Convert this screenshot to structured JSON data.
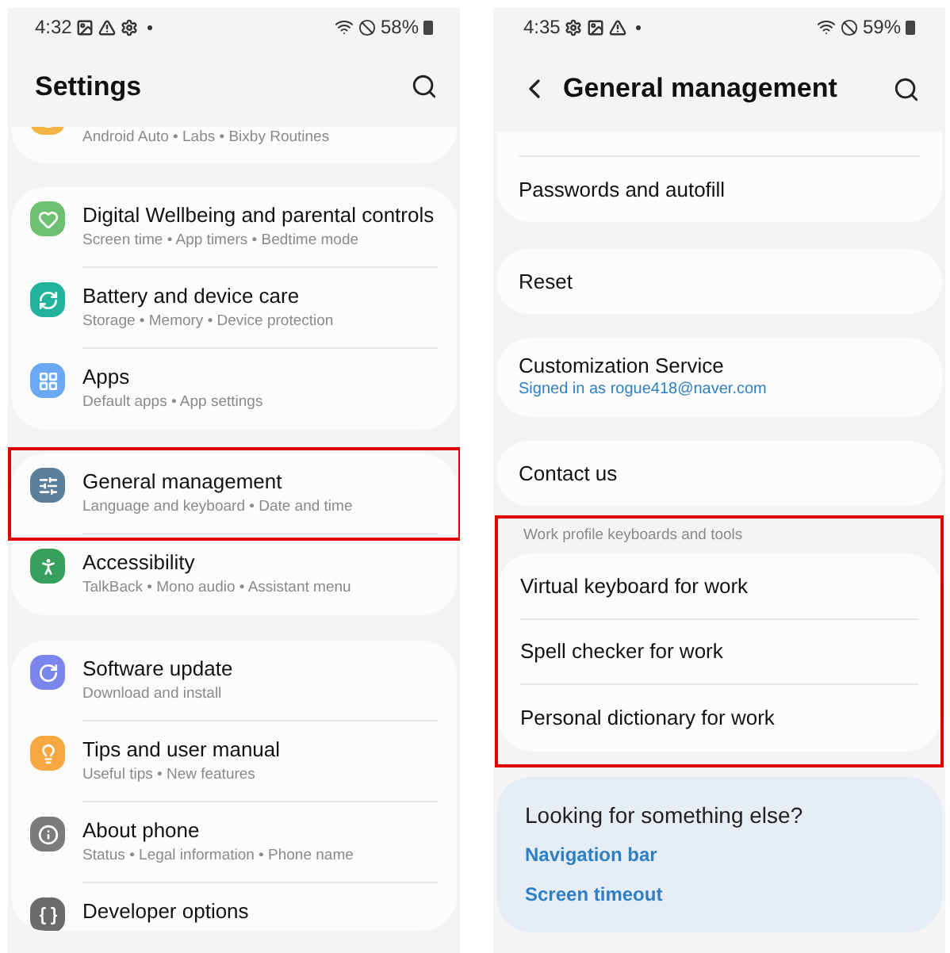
{
  "screens": [
    {
      "status_bar": {
        "time": "4:32",
        "notification_icons": [
          {
            "kind": "image"
          },
          {
            "kind": "warning"
          },
          {
            "kind": "gear"
          },
          {
            "kind": "dot"
          }
        ],
        "battery": "58%"
      },
      "header": {
        "title": "Settings",
        "back": false
      },
      "groups": [
        {
          "kind": "partial",
          "items": [
            {
              "kind": "auto",
              "color": "#f5b544",
              "subtitle": "Android Auto • Labs • Bixby Routines"
            }
          ]
        },
        {
          "kind": "card",
          "items": [
            {
              "kind": "wellbeing",
              "color": "#6cc070",
              "title": "Digital Wellbeing and parental controls",
              "subtitle": "Screen time • App timers • Bedtime mode",
              "highlighted": false
            },
            {
              "kind": "battery",
              "color": "#21b29b",
              "title": "Battery and device care",
              "subtitle": "Storage • Memory • Device protection",
              "highlighted": false
            },
            {
              "kind": "apps",
              "color": "#6aa8f4",
              "title": "Apps",
              "subtitle": "Default apps • App settings",
              "highlighted": false
            }
          ]
        },
        {
          "kind": "card",
          "items": [
            {
              "kind": "general",
              "color": "#5b7f99",
              "title": "General management",
              "subtitle": "Language and keyboard • Date and time",
              "highlighted": true
            },
            {
              "kind": "accessibility",
              "color": "#36a05c",
              "title": "Accessibility",
              "subtitle": "TalkBack • Mono audio • Assistant menu",
              "highlighted": false
            }
          ]
        },
        {
          "kind": "clipped",
          "items": [
            {
              "kind": "update",
              "color": "#7a86ec",
              "title": "Software update",
              "subtitle": "Download and install",
              "highlighted": false
            },
            {
              "kind": "tips",
              "color": "#f5a742",
              "title": "Tips and user manual",
              "subtitle": "Useful tips • New features",
              "highlighted": false
            },
            {
              "kind": "about",
              "color": "#7b7b7b",
              "title": "About phone",
              "subtitle": "Status • Legal information • Phone name",
              "highlighted": false
            },
            {
              "kind": "developer",
              "color": "#6b6b6b",
              "title": "Developer options",
              "highlighted": false
            }
          ]
        }
      ]
    },
    {
      "status_bar": {
        "time": "4:35",
        "notification_icons": [
          {
            "kind": "gear"
          },
          {
            "kind": "image"
          },
          {
            "kind": "warning"
          },
          {
            "kind": "dot"
          }
        ],
        "battery": "59%"
      },
      "header": {
        "title": "General management",
        "back": true
      },
      "groups": [
        {
          "kind": "cut_list",
          "items": [
            {
              "title": "Passwords and autofill"
            }
          ]
        },
        {
          "kind": "plain",
          "items": [
            {
              "title": "Reset"
            }
          ]
        },
        {
          "kind": "plain",
          "items": [
            {
              "title": "Customization Service",
              "subtitle": "Signed in as rogue418@naver.com"
            }
          ]
        },
        {
          "kind": "plain",
          "items": [
            {
              "title": "Contact us"
            }
          ]
        },
        {
          "kind": "section",
          "heading": "Work profile keyboards and tools",
          "highlighted": true,
          "items": [
            {
              "title": "Virtual keyboard for work"
            },
            {
              "title": "Spell checker for work"
            },
            {
              "title": "Personal dictionary for work"
            }
          ]
        },
        {
          "kind": "suggestions",
          "title": "Looking for something else?",
          "links": [
            "Navigation bar",
            "Screen timeout"
          ]
        }
      ]
    }
  ]
}
